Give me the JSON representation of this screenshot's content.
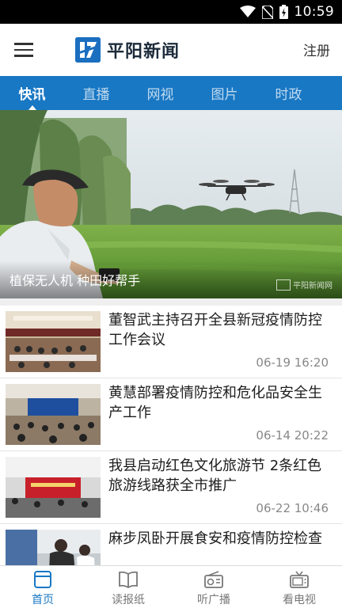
{
  "status_bar": {
    "time": "10:59"
  },
  "header": {
    "app_name": "平阳新闻",
    "register_label": "注册"
  },
  "tabs": [
    {
      "label": "快讯",
      "active": true
    },
    {
      "label": "直播",
      "active": false
    },
    {
      "label": "网视",
      "active": false
    },
    {
      "label": "图片",
      "active": false
    },
    {
      "label": "时政",
      "active": false
    }
  ],
  "hero": {
    "caption": "植保无人机 种田好帮手",
    "watermark": "平阳新闻网"
  },
  "news": [
    {
      "title": "董智武主持召开全县新冠疫情防控工作会议",
      "time": "06-19 16:20"
    },
    {
      "title": "黄慧部署疫情防控和危化品安全生产工作",
      "time": "06-14 20:22"
    },
    {
      "title": "我县启动红色文化旅游节 2条红色旅游线路获全市推广",
      "time": "06-22 10:46"
    },
    {
      "title": "麻步凤卧开展食安和疫情防控检查",
      "time": ""
    }
  ],
  "bottom_nav": [
    {
      "label": "首页",
      "icon": "home-window-icon",
      "active": true
    },
    {
      "label": "读报纸",
      "icon": "open-book-icon",
      "active": false
    },
    {
      "label": "听广播",
      "icon": "radio-icon",
      "active": false
    },
    {
      "label": "看电视",
      "icon": "tv-icon",
      "active": false
    }
  ],
  "colors": {
    "brand_blue": "#1978c4",
    "status_bar": "#000000",
    "text_dark": "#1d1d1d",
    "time_gray": "#888888"
  }
}
